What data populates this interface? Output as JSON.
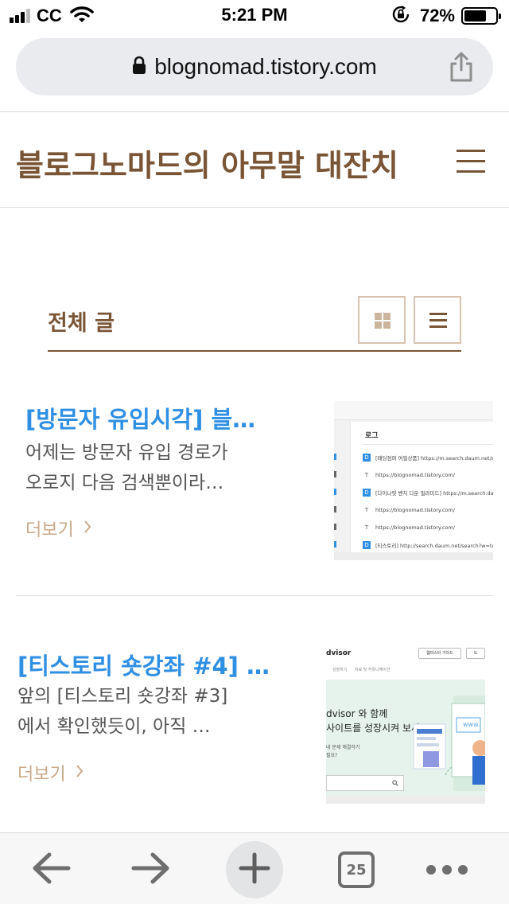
{
  "status_bar": {
    "carrier": "CC",
    "time": "5:21 PM",
    "battery_percent": "72%",
    "battery_level": 0.72,
    "icons": [
      "signal-icon",
      "wifi-icon",
      "orientation-lock-icon",
      "battery-icon"
    ]
  },
  "browser": {
    "url": "blognomad.tistory.com",
    "icons": [
      "lock-icon",
      "share-icon"
    ]
  },
  "blog": {
    "title": "블로그노마드의 아무말 대잔치",
    "menu_icon": "hamburger-icon"
  },
  "section": {
    "title": "전체 글",
    "view_options": [
      "grid-view-icon",
      "list-view-icon"
    ],
    "selected_view": "list"
  },
  "posts": [
    {
      "title": "[방문자 유입시각] 블…",
      "excerpt_line1": "어제는 방문자 유입 경로가",
      "excerpt_line2": "오로지 다음 검색뿐이라…",
      "more_label": "더보기",
      "thumbnail": {
        "heading": "로그",
        "rows": [
          {
            "badge": "D",
            "text": "[패딩점퍼 여필상품] https://m.search.daum.net/s"
          },
          {
            "badge": "T",
            "text": "https://blognomad.tistory.com/"
          },
          {
            "badge": "D",
            "text": "[다이나핏 벤치 다운 필라미드] https://m.search.da"
          },
          {
            "badge": "T",
            "text": "https://blognomad.tistory.com/"
          },
          {
            "badge": "T",
            "text": "https://blognomad.tistory.com/"
          },
          {
            "badge": "D",
            "text": "[티스토리] http://search.daum.net/search?w=tot"
          }
        ]
      }
    },
    {
      "title": "[티스토리 숏강좌 #4] …",
      "excerpt_line1": "앞의 [티스토리 숏강좌 #3]",
      "excerpt_line2": "에서 확인했듯이, 아직 …",
      "more_label": "더보기",
      "thumbnail": {
        "brand": "dvisor",
        "top_btn1": "웹마스터 가이드",
        "top_btn2": "도",
        "nav": "     성장하기      자료 및 커뮤니케이션",
        "headline1": "dvisor 와 함께",
        "headline2": "사이트를 성장시켜 보세요",
        "sub1": "네 문제 해결하기",
        "sub2": "필요?",
        "badge_text": "www."
      }
    }
  ],
  "toolbar": {
    "tabs_count": "25",
    "icons": [
      "back-arrow-icon",
      "forward-arrow-icon",
      "plus-icon",
      "tabs-icon",
      "more-icon"
    ]
  },
  "colors": {
    "brand_brown": "#7a5535",
    "link_blue": "#2e8fe3",
    "muted_tan": "#c9a98a",
    "url_bar_bg": "#e9ebee"
  }
}
